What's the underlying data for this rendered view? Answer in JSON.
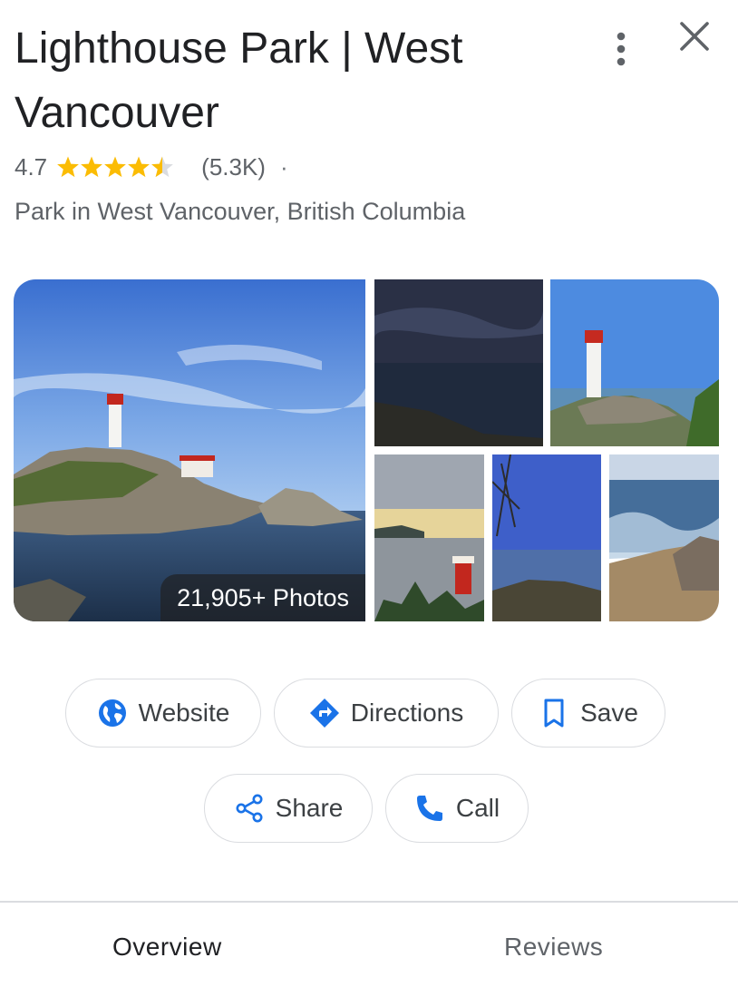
{
  "place": {
    "title": "Lighthouse Park | West Vancouver",
    "rating_value": "4.7",
    "rating_fraction": 0.94,
    "review_count": "(5.3K)",
    "separator": "·",
    "subtitle": "Park in West Vancouver, British Columbia"
  },
  "header": {
    "more_icon": "more-vert-icon",
    "close_icon": "close-icon"
  },
  "photos": {
    "count_label": "21,905+ Photos"
  },
  "actions": [
    {
      "label": "Website",
      "icon": "globe-icon"
    },
    {
      "label": "Directions",
      "icon": "directions-icon"
    },
    {
      "label": "Save",
      "icon": "bookmark-icon"
    },
    {
      "label": "Share",
      "icon": "share-icon"
    },
    {
      "label": "Call",
      "icon": "phone-icon"
    }
  ],
  "tabs": [
    {
      "label": "Overview",
      "active": true
    },
    {
      "label": "Reviews",
      "active": false
    }
  ],
  "colors": {
    "accent": "#1a73e8",
    "star": "#fbbc04",
    "text_primary": "#202124",
    "text_secondary": "#5f6368"
  }
}
